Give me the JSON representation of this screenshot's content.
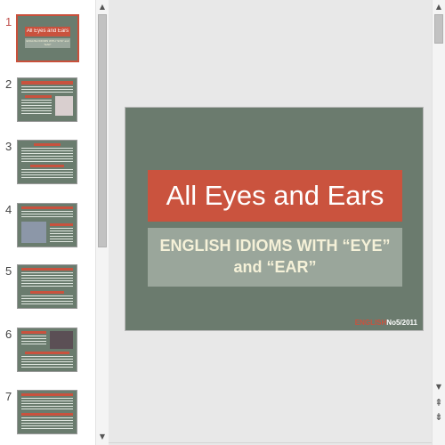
{
  "thumbnails": [
    {
      "number": "1",
      "title": "All Eyes and Ears",
      "subtitle": "ENGLISH IDIOMS WITH \"EYE\" and \"EAR\""
    },
    {
      "number": "2"
    },
    {
      "number": "3"
    },
    {
      "number": "4"
    },
    {
      "number": "5"
    },
    {
      "number": "6"
    },
    {
      "number": "7"
    }
  ],
  "slide": {
    "title": "All Eyes and Ears",
    "subtitle_line1": "ENGLISH IDIOMS WITH “EYE”",
    "subtitle_line2": "and “EAR”",
    "footer_red": "ENGLISH",
    "footer_white": "No5/2011"
  },
  "colors": {
    "slide_background": "#6b7b6e",
    "accent_red": "#ca533e",
    "subtitle_box": "#9aa69b",
    "subtitle_text": "#f5f1d8"
  },
  "icons": {
    "scroll_up": "▲",
    "scroll_down": "▼",
    "prev_slide": "⇞",
    "next_slide": "⇟"
  }
}
